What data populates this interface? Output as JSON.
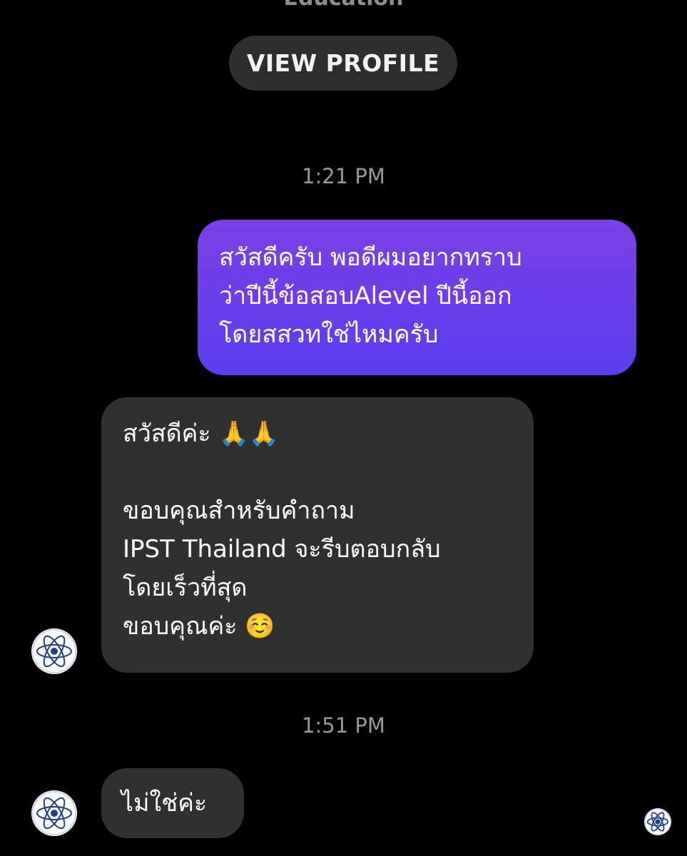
{
  "header": {
    "subtitle": "Education",
    "view_profile_label": "VIEW PROFILE"
  },
  "messages": [
    {
      "timestamp": "1:21 PM"
    },
    {
      "direction": "outgoing",
      "lines": [
        "สวัสดีครับ พอดีผมอยากทราบ",
        "ว่าปีนี้ข้อสอบAlevel ปีนี้ออก",
        "โดยสสวทใช่ไหมครับ"
      ]
    },
    {
      "direction": "incoming",
      "lines": [
        "สวัสดีค่ะ 🙏🙏",
        "",
        "ขอบคุณสำหรับคำถาม",
        "IPST Thailand  จะรีบตอบกลับ",
        "โดยเร็วที่สุด",
        "ขอบคุณค่ะ ☺️"
      ]
    },
    {
      "timestamp": "1:51 PM"
    },
    {
      "direction": "incoming",
      "lines": [
        "ไม่ใช่ค่ะ"
      ]
    }
  ],
  "colors": {
    "background": "#000000",
    "outgoing_bubble_top": "#7c3fe6",
    "outgoing_bubble_bottom": "#5a3ef0",
    "incoming_bubble": "#303030",
    "timestamp_text": "#9a9a9a",
    "avatar_logo": "#1d3f8f"
  },
  "icons": {
    "sender_avatar": "ipst-logo-avatar-icon",
    "seen_indicator": "ipst-logo-seen-icon"
  }
}
